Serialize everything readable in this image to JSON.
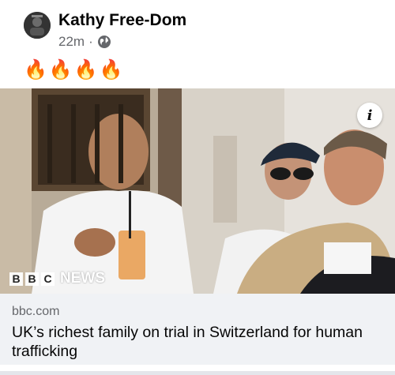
{
  "post": {
    "author_name": "Kathy Free-Dom",
    "timestamp": "22m",
    "separator": "·",
    "audience_icon": "globe-icon",
    "text": "🔥🔥🔥🔥"
  },
  "media": {
    "info_icon": "info-icon",
    "info_label": "i",
    "watermark_letters": [
      "B",
      "B",
      "C"
    ],
    "watermark_word": "NEWS"
  },
  "link_preview": {
    "domain": "bbc.com",
    "headline": "UK’s richest family on trial in Switzerland for human trafficking"
  },
  "colors": {
    "card_background": "#f0f2f5",
    "secondary_text": "#65676b",
    "primary_text": "#050505"
  }
}
